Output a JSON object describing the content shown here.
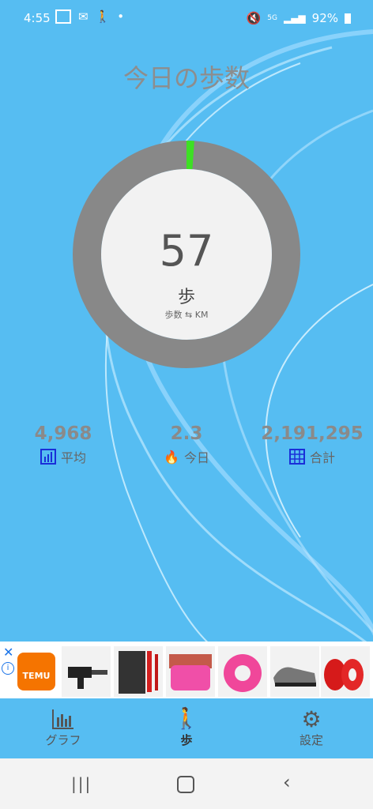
{
  "status": {
    "time": "4:55",
    "battery": "92%",
    "signal": "5G"
  },
  "title": "今日の歩数",
  "progress": {
    "steps": "57",
    "unit": "歩",
    "toggle_label": "歩数 ⇆ KM",
    "fraction": 0.011,
    "color_progress": "#3de024",
    "color_track": "#888888"
  },
  "stats": [
    {
      "value": "4,968",
      "label": "平均",
      "icon": "bar-chart-icon"
    },
    {
      "value": "2.3",
      "label": "今日",
      "icon": "flame-icon"
    },
    {
      "value": "2,191,295",
      "label": "合計",
      "icon": "grid-chart-icon"
    }
  ],
  "ad": {
    "brand": "TEMU"
  },
  "nav": {
    "graph": "グラフ",
    "steps": "歩",
    "settings": "設定"
  },
  "colors": {
    "background": "#56bdf2",
    "accent": "#3de024"
  }
}
